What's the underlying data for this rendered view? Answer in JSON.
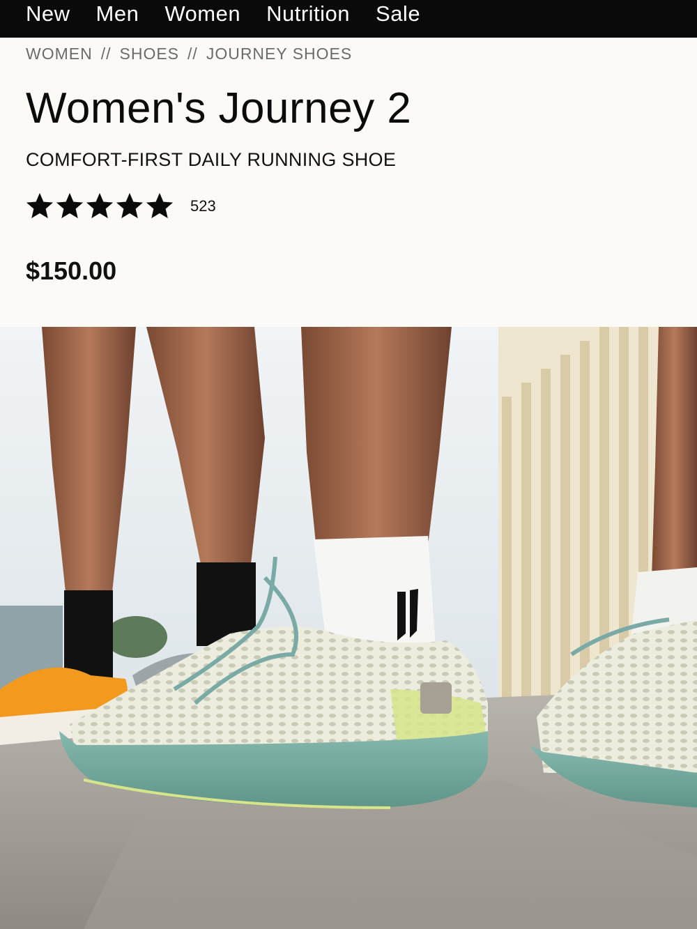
{
  "nav": {
    "items": [
      {
        "label": "New"
      },
      {
        "label": "Men"
      },
      {
        "label": "Women"
      },
      {
        "label": "Nutrition"
      },
      {
        "label": "Sale"
      }
    ]
  },
  "breadcrumb": {
    "items": [
      {
        "label": "WOMEN"
      },
      {
        "label": "SHOES"
      },
      {
        "label": "JOURNEY SHOES"
      }
    ],
    "separator": "//"
  },
  "product": {
    "title": "Women's Journey 2",
    "subtitle": "COMFORT-FIRST DAILY RUNNING SHOE",
    "rating": {
      "stars": 5,
      "max": 5,
      "count": "523"
    },
    "price": "$150.00"
  },
  "hero_image": {
    "alt": "Runners wearing Journey 2 shoes"
  },
  "colors": {
    "nav_bg": "#0a0a0a",
    "page_bg": "#fbfaf6",
    "shoe_sole": "#6fa99d",
    "shoe_upper": "#e6e7d6",
    "accent_yellow": "#d7e58a",
    "orange_shoe": "#f39a1e"
  }
}
